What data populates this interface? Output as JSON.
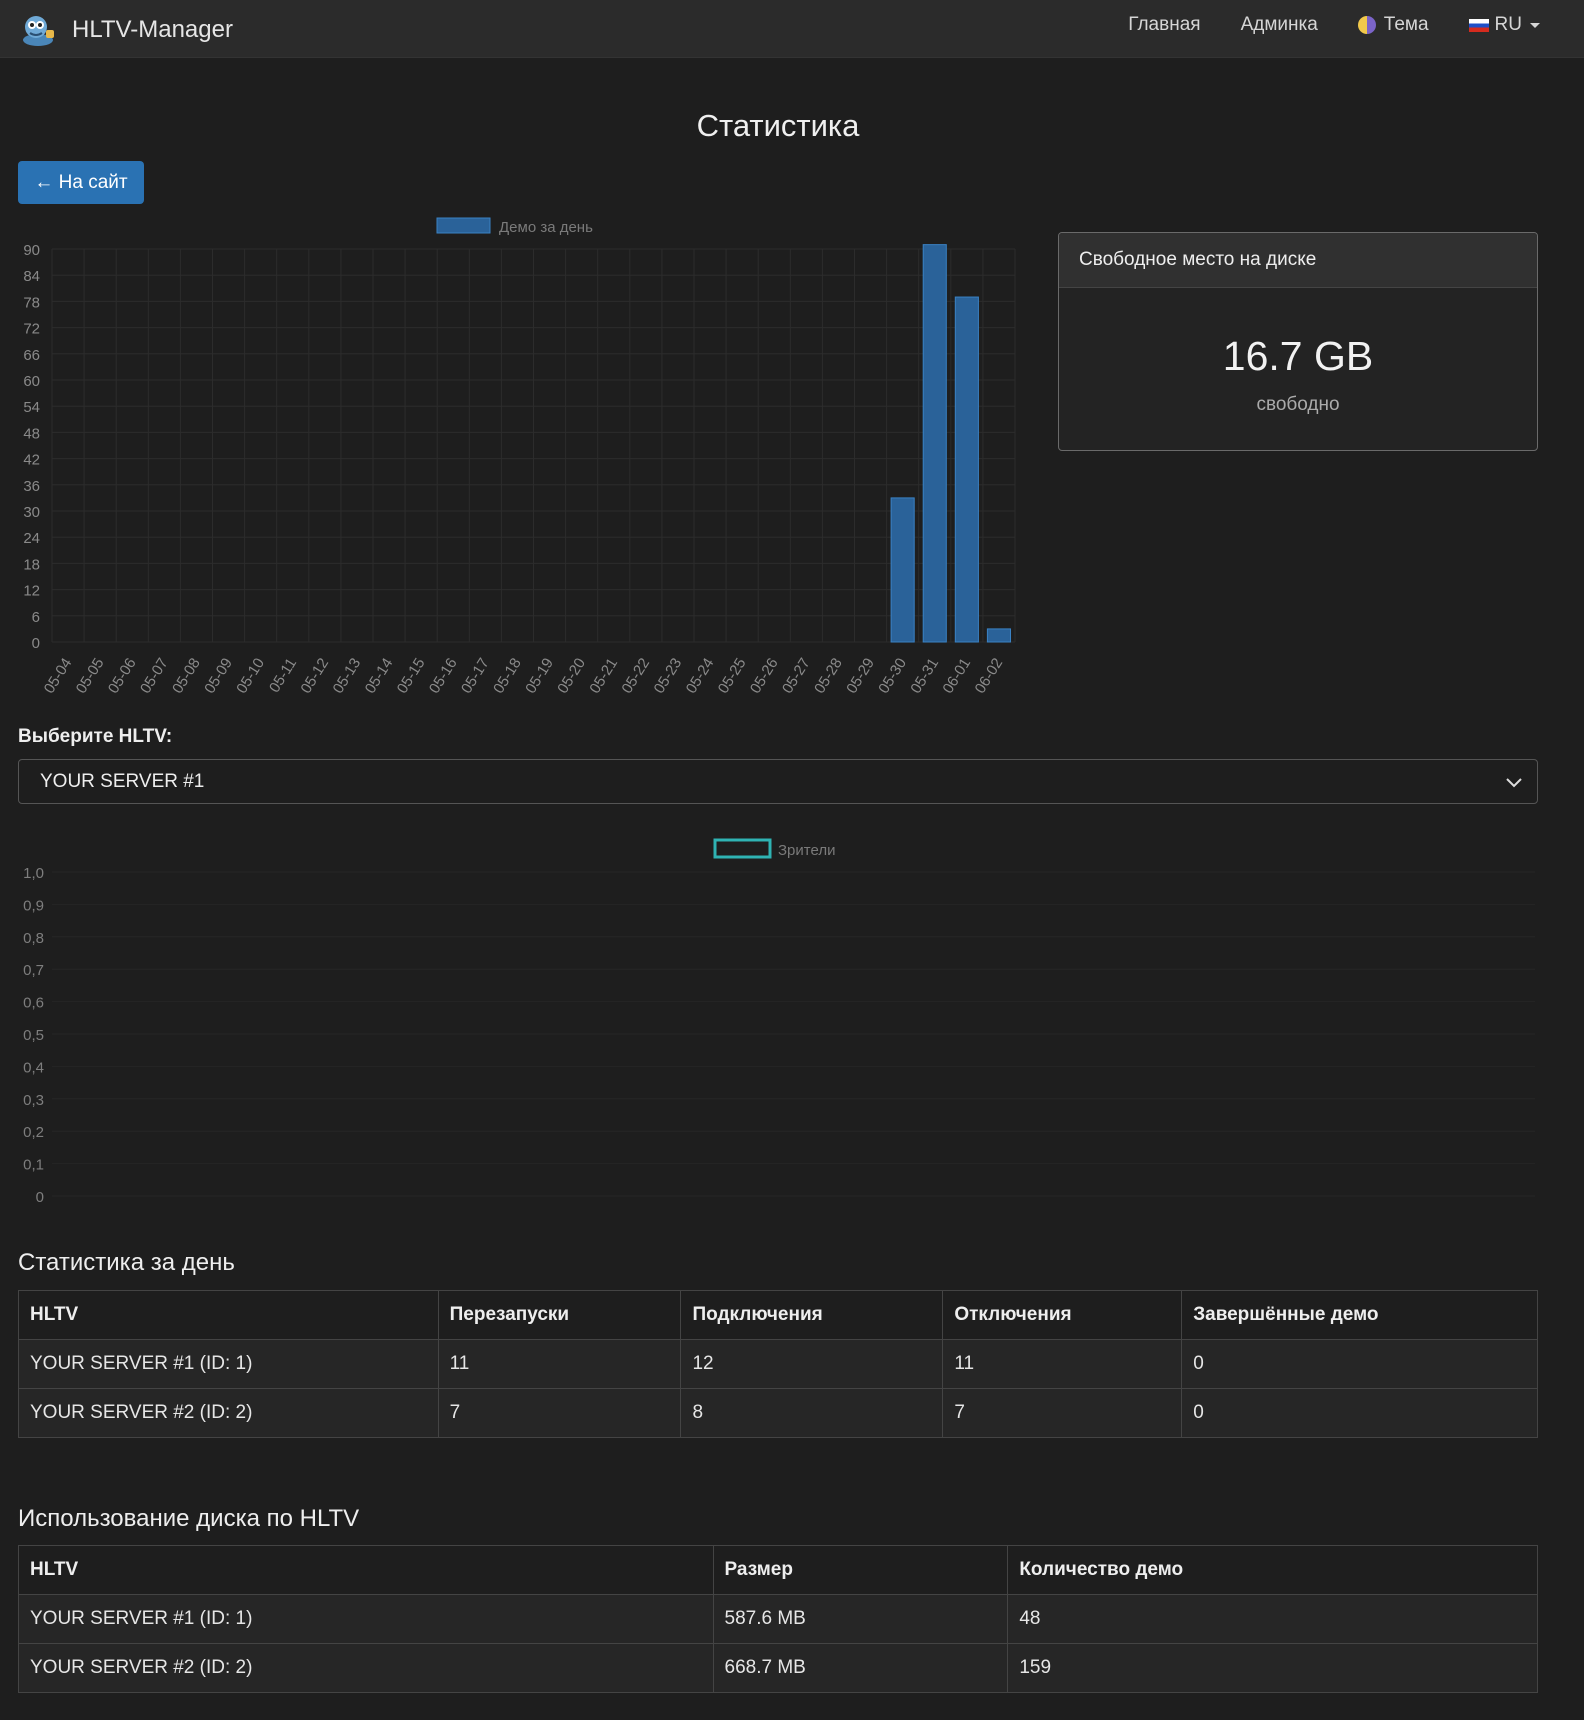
{
  "header": {
    "title": "HLTV-Manager",
    "nav": {
      "home": "Главная",
      "admin": "Админка",
      "theme": "Тема",
      "lang": "RU"
    }
  },
  "page": {
    "title": "Статистика",
    "back_label": "← На сайт"
  },
  "disk": {
    "title": "Свободное место на диске",
    "value": "16.7 GB",
    "sub": "свободно"
  },
  "selector": {
    "label": "Выберите HLTV:",
    "selected": "YOUR SERVER #1"
  },
  "daily_stats": {
    "title": "Статистика за день",
    "headers": [
      "HLTV",
      "Перезапуски",
      "Подключения",
      "Отключения",
      "Завершённые демо"
    ],
    "rows": [
      [
        "YOUR SERVER #1 (ID: 1)",
        "11",
        "12",
        "11",
        "0"
      ],
      [
        "YOUR SERVER #2 (ID: 2)",
        "7",
        "8",
        "7",
        "0"
      ]
    ]
  },
  "disk_usage": {
    "title": "Использование диска по HLTV",
    "headers": [
      "HLTV",
      "Размер",
      "Количество демо"
    ],
    "rows": [
      [
        "YOUR SERVER #1 (ID: 1)",
        "587.6 MB",
        "48"
      ],
      [
        "YOUR SERVER #2 (ID: 2)",
        "668.7 MB",
        "159"
      ]
    ]
  },
  "colors": {
    "bar": "#2a6299",
    "bar_border": "#3a82c4",
    "viewers": "#2fb3b3",
    "accent": "#2a72b3"
  },
  "chart_data": [
    {
      "type": "bar",
      "legend": "Демо за день",
      "legend_position": "top",
      "grid": true,
      "categories": [
        "05-04",
        "05-05",
        "05-06",
        "05-07",
        "05-08",
        "05-09",
        "05-10",
        "05-11",
        "05-12",
        "05-13",
        "05-14",
        "05-15",
        "05-16",
        "05-17",
        "05-18",
        "05-19",
        "05-20",
        "05-21",
        "05-22",
        "05-23",
        "05-24",
        "05-25",
        "05-26",
        "05-27",
        "05-28",
        "05-29",
        "05-30",
        "05-31",
        "06-01",
        "06-02"
      ],
      "series": [
        {
          "name": "Демо за день",
          "values": [
            0,
            0,
            0,
            0,
            0,
            0,
            0,
            0,
            0,
            0,
            0,
            0,
            0,
            0,
            0,
            0,
            0,
            0,
            0,
            0,
            0,
            0,
            0,
            0,
            0,
            0,
            33,
            91,
            79,
            3
          ]
        }
      ],
      "ylim": [
        0,
        90
      ],
      "yticks": [
        "0",
        "6",
        "12",
        "18",
        "24",
        "30",
        "36",
        "42",
        "48",
        "54",
        "60",
        "66",
        "72",
        "78",
        "84",
        "90"
      ]
    },
    {
      "type": "line",
      "legend": "Зрители",
      "legend_position": "top",
      "grid": true,
      "series": [
        {
          "name": "Зрители",
          "values": []
        }
      ],
      "ylim": [
        0,
        1
      ],
      "yticks": [
        "0",
        "0,1",
        "0,2",
        "0,3",
        "0,4",
        "0,5",
        "0,6",
        "0,7",
        "0,8",
        "0,9",
        "1,0"
      ]
    }
  ]
}
